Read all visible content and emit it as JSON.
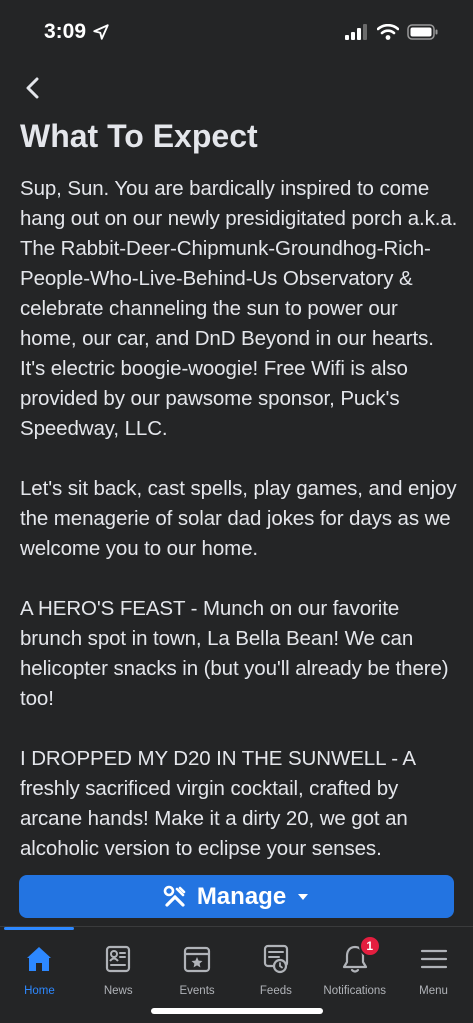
{
  "status_bar": {
    "time": "3:09"
  },
  "header": {
    "title": "What To Expect"
  },
  "content": {
    "paragraphs": [
      "Sup, Sun. You are bardically inspired to come hang out on our newly presidigitated porch a.k.a. The Rabbit-Deer-Chipmunk-Groundhog-Rich-People-Who-Live-Behind-Us Observatory & celebrate channeling the sun to power our home, our car, and DnD Beyond in our hearts. It's electric boogie-woogie! Free Wifi is also provided by our pawsome sponsor, Puck's Speedway, LLC.",
      "Let's sit back, cast spells, play games, and enjoy the menagerie of solar dad jokes for days as we welcome you to our home.",
      "A HERO'S FEAST - Munch on our favorite brunch spot in town, La Bella Bean! We can helicopter snacks in (but you'll already be there) too!",
      "I DROPPED MY D20 IN THE SUNWELL - A freshly sacrificed virgin cocktail, crafted by arcane hands! Make it a dirty 20, we got an alcoholic version to eclipse your senses."
    ]
  },
  "manage_button": {
    "label": "Manage"
  },
  "tab_bar": {
    "tabs": [
      {
        "label": "Home",
        "icon": "home-icon",
        "active": true
      },
      {
        "label": "News",
        "icon": "news-icon"
      },
      {
        "label": "Events",
        "icon": "events-icon"
      },
      {
        "label": "Feeds",
        "icon": "feeds-icon"
      },
      {
        "label": "Notifications",
        "icon": "bell-icon",
        "badge": "1"
      },
      {
        "label": "Menu",
        "icon": "menu-icon"
      }
    ]
  },
  "colors": {
    "background": "#242526",
    "accent": "#2d88ff",
    "button": "#2374e1",
    "badge": "#e41e3f"
  }
}
